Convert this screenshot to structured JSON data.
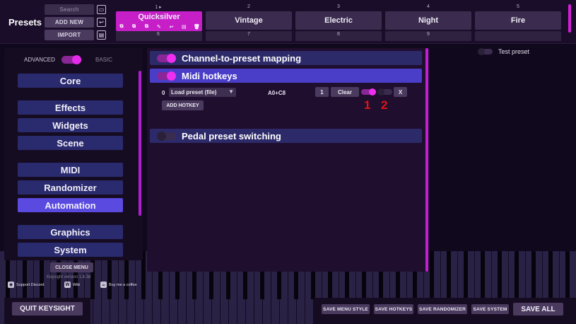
{
  "header": {
    "title": "Presets",
    "search_placeholder": "Search",
    "add_new_label": "ADD NEW",
    "import_label": "IMPORT"
  },
  "preset_slots": [
    {
      "number": "1",
      "name": "Quicksilver",
      "active": true
    },
    {
      "number": "2",
      "name": "Vintage"
    },
    {
      "number": "3",
      "name": "Electric"
    },
    {
      "number": "4",
      "name": "Night"
    },
    {
      "number": "5",
      "name": "Fire"
    }
  ],
  "preset_slots_row2": [
    "6",
    "7",
    "8",
    "9"
  ],
  "mode": {
    "advanced_label": "ADVANCED",
    "basic_label": "BASIC",
    "advanced_on": true
  },
  "menu": {
    "items": [
      "Core",
      "Effects",
      "Widgets",
      "Scene",
      "MIDI",
      "Randomizer",
      "Automation",
      "Graphics",
      "System"
    ],
    "active": "Automation",
    "close_label": "CLOSE MENU",
    "version": "Keysight version 1.6.3d"
  },
  "links": {
    "discord": "Support Discord",
    "wiki": "Wiki",
    "coffee": "Buy me a coffee"
  },
  "sections": {
    "channel_mapping": {
      "title": "Channel-to-preset mapping",
      "enabled": true
    },
    "midi_hotkeys": {
      "title": "Midi hotkeys",
      "enabled": true
    },
    "pedal_switching": {
      "title": "Pedal preset switching",
      "enabled": false
    }
  },
  "hotkey_row": {
    "index": "0",
    "action": "Load preset (file)",
    "keys": "A0+C8",
    "preset_number": "1",
    "clear_label": "Clear",
    "remove_label": "X",
    "toggle_1_on": true,
    "toggle_2_on": false
  },
  "add_hotkey_label": "ADD HOTKEY",
  "annotations": {
    "one": "1",
    "two": "2"
  },
  "test_preset_label": "Test preset",
  "bottom": {
    "quit_label": "QUIT KEYSIGHT",
    "save_menu_style": "SAVE MENU STYLE",
    "save_hotkeys": "SAVE HOTKEYS",
    "save_randomizer": "SAVE RANDOMIZER",
    "save_system": "SAVE SYSTEM",
    "save_all": "SAVE ALL"
  },
  "colors": {
    "accent": "#c61fc8",
    "menu_button": "#2a2a6e",
    "menu_active": "#5a4ae0",
    "annotation_red": "#e31414"
  }
}
